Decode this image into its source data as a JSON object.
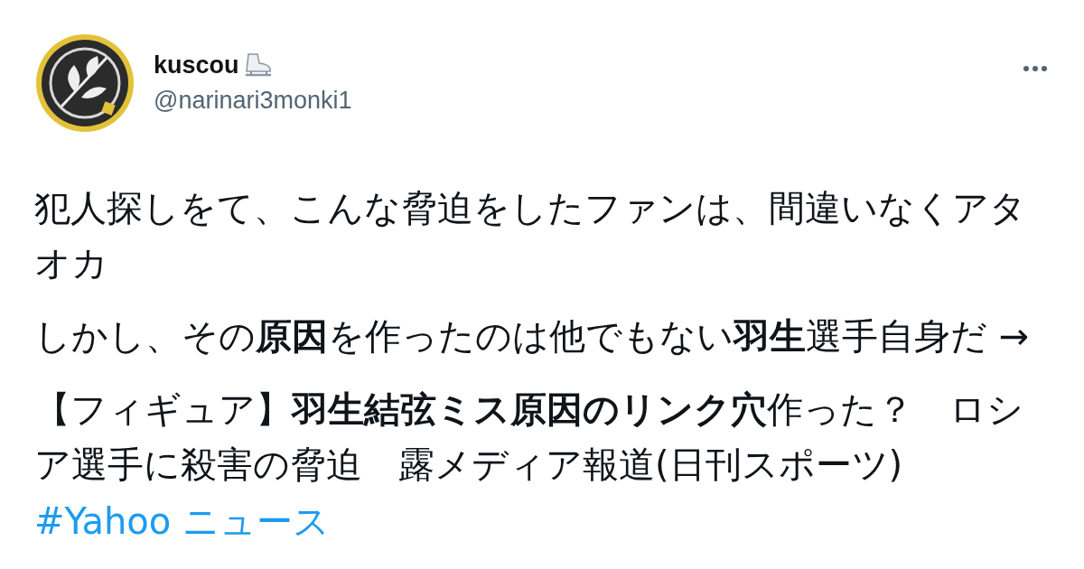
{
  "tweet": {
    "author": {
      "name": "kuscou",
      "handle": "@narinari3monki1"
    },
    "paragraphs": [
      "犯人探しをて、こんな脅迫をしたファンは、間違いなくアタオカ",
      "しかし、その**原因**を作ったのは他でもない**羽生**選手自身だ →",
      "【フィギュア】**羽生結弦ミス原因のリンク穴**作った？　ロシア選手に殺害の脅迫　露メディア報道(日刊スポーツ)"
    ],
    "hashtag": "#Yahoo ニュース"
  }
}
